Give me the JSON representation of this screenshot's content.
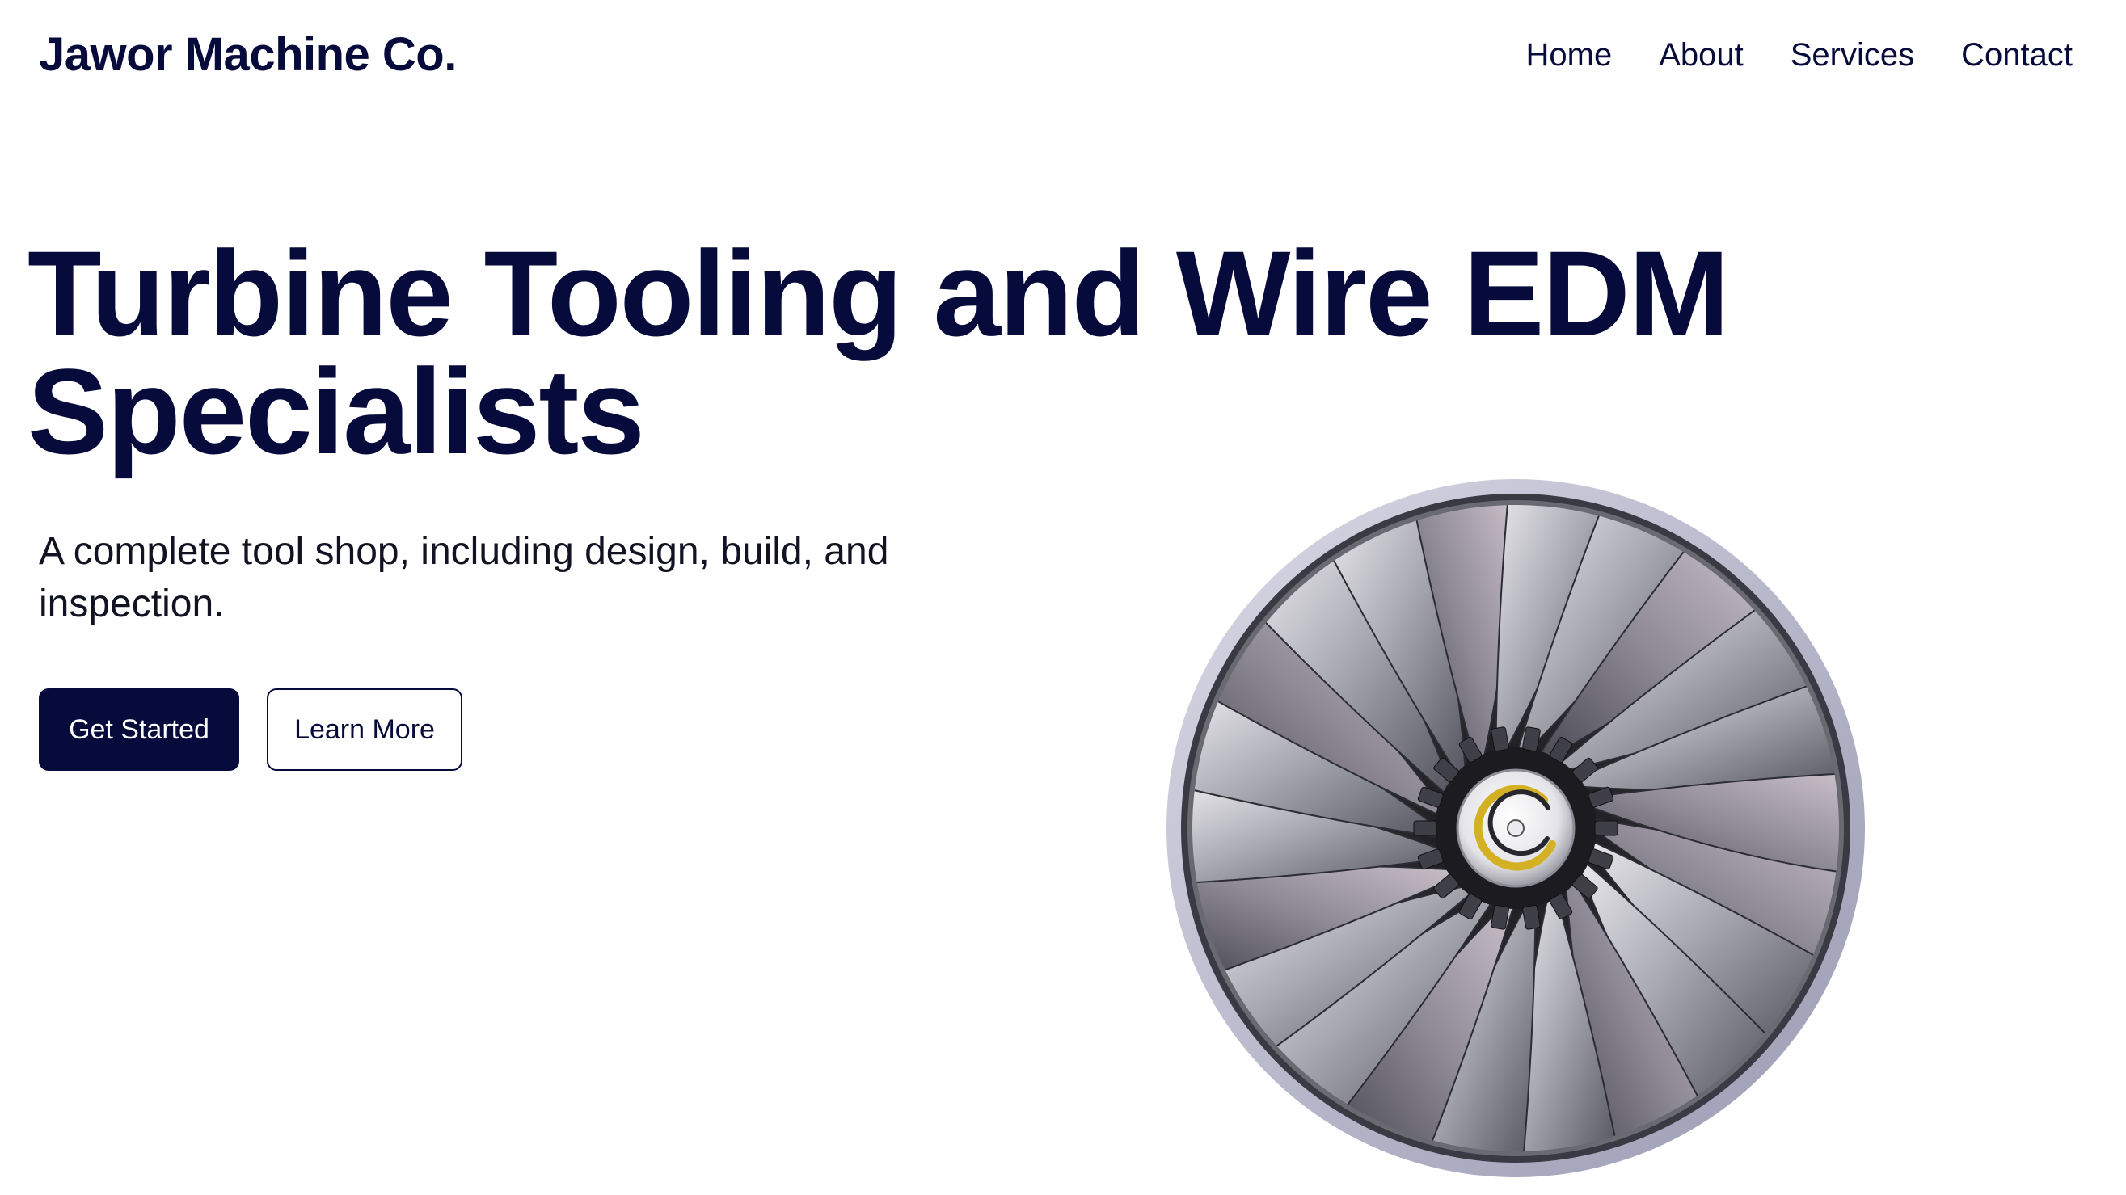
{
  "colors": {
    "navy": "#070b3b",
    "white": "#ffffff"
  },
  "header": {
    "brand": "Jawor Machine Co.",
    "nav": [
      {
        "label": "Home"
      },
      {
        "label": "About"
      },
      {
        "label": "Services"
      },
      {
        "label": "Contact"
      }
    ]
  },
  "hero": {
    "title": "Turbine Tooling and Wire EDM Specialists",
    "subtitle": "A complete tool shop, including design, build, and inspection.",
    "primary_button": "Get Started",
    "secondary_button": "Learn More",
    "image": {
      "subject": "jet-engine-turbine-fan",
      "icon": "turbine-fan-icon"
    }
  }
}
